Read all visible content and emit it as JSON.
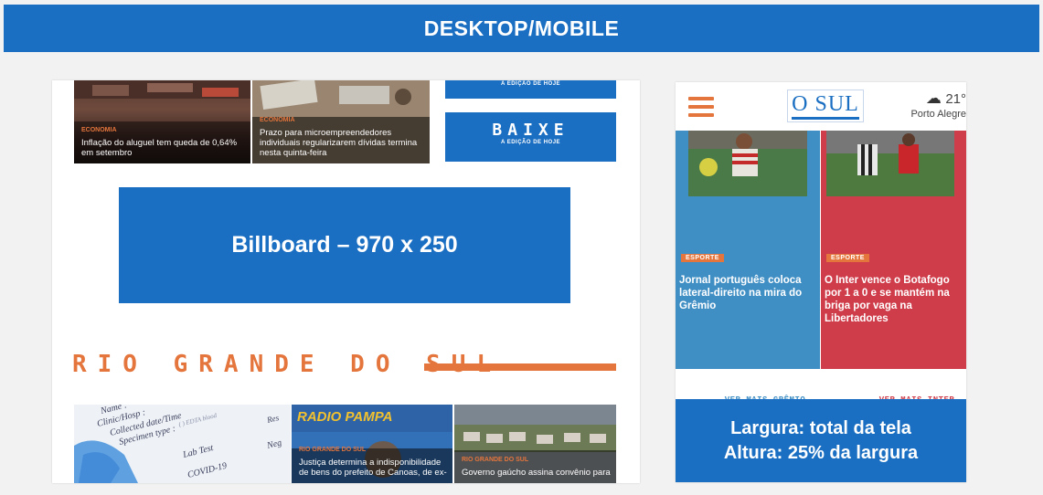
{
  "header": {
    "title": "DESKTOP/MOBILE"
  },
  "desktop": {
    "top_articles": [
      {
        "category": "ECONOMIA",
        "headline": "Inflação do aluguel tem queda de 0,64% em setembro"
      },
      {
        "category": "ECONOMIA",
        "headline": "Prazo para microempreendedores individuais regularizarem dívidas termina nesta quinta-feira"
      }
    ],
    "edition_banner_top": {
      "subtitle": "A EDIÇÃO DE HOJE"
    },
    "edition_banner": {
      "title": "BAIXE",
      "subtitle": "A EDIÇÃO DE HOJE"
    },
    "billboard": {
      "label": "Billboard – 970 x 250"
    },
    "section": {
      "title": "RIO GRANDE DO SUL"
    },
    "bottom_articles": [
      {
        "category": "",
        "headline": ""
      },
      {
        "category": "RIO GRANDE DO SUL",
        "headline": "Justiça determina a indisponibilidade de bens do prefeito de Canoas, de ex-"
      },
      {
        "category": "RIO GRANDE DO SUL",
        "headline": "Governo gaúcho assina convênio para"
      }
    ],
    "photo_texts": {
      "lab_lines": [
        "Name :",
        "Clinic/Hosp :",
        "Collected date/Time",
        "Specimen type :",
        "( ) EDTA blood",
        "Lab Test",
        "COVID-19",
        "Res",
        "Neg"
      ],
      "radio_name": "RADIO PAMPA"
    }
  },
  "mobile": {
    "logo": "O SUL",
    "weather": {
      "temp": "21°",
      "city": "Porto Alegre"
    },
    "articles": [
      {
        "category": "ESPORTE",
        "headline": "Jornal português coloca lateral-direito na mira do Grêmio",
        "button": "VER MAIS GRÊMIO",
        "color": "#3f8ec4"
      },
      {
        "category": "ESPORTE",
        "headline": "O Inter vence o Botafogo por 1 a 0 e se mantém na briga por vaga na Libertadores",
        "button": "VER MAIS INTER",
        "color": "#cf3c4a"
      }
    ]
  },
  "note": {
    "line1": "Largura: total da tela",
    "line2": "Altura: 25% da largura"
  },
  "colors": {
    "brand_blue": "#1b6fc2",
    "accent_orange": "#e4753c",
    "gremio_blue": "#3f8ec4",
    "inter_red": "#cf3c4a"
  }
}
